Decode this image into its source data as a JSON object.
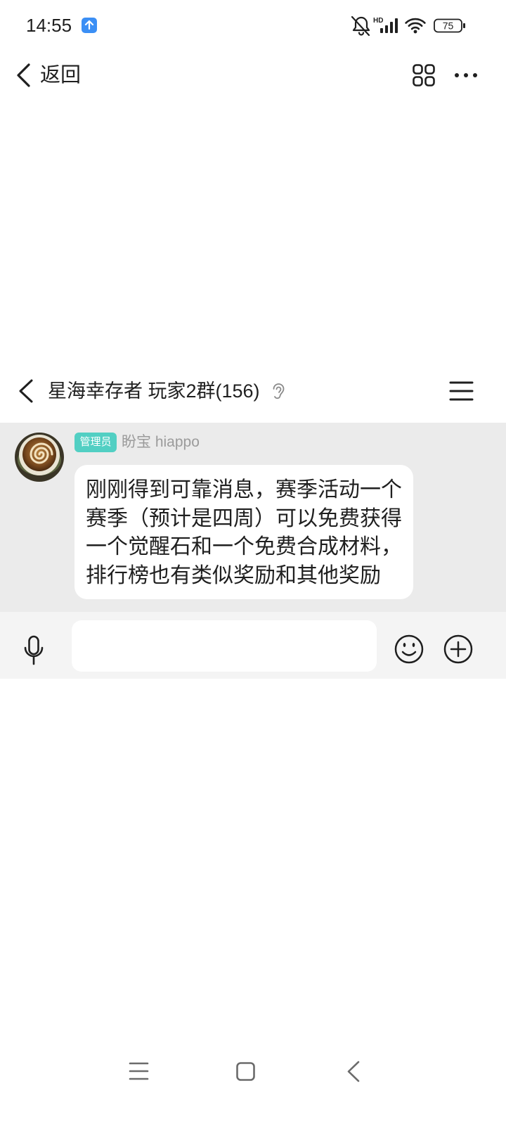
{
  "status_bar": {
    "time": "14:55",
    "network_type": "HD",
    "battery_level": "75",
    "icons": [
      "upload-notification-icon",
      "bell-off-icon",
      "cellular-signal-icon",
      "wifi-icon",
      "battery-icon"
    ]
  },
  "top_nav": {
    "back_label": "返回",
    "icons": [
      "back-chevron-icon",
      "grid-apps-icon",
      "more-dots-icon"
    ]
  },
  "chat_header": {
    "title": "星海幸存者 玩家2群(156)",
    "icons": [
      "back-chevron-icon",
      "ear-icon",
      "menu-icon"
    ]
  },
  "message": {
    "badge": "管理员",
    "sender": "盼宝 hiappo",
    "avatar_icon": "latte-art-avatar",
    "lines": [
      "刚刚得到可靠消息，赛季活动一个",
      "赛季（预计是四周）可以免费获得",
      "一个觉醒石和一个免费合成材料，",
      "排行榜也有类似奖励和其他奖励"
    ]
  },
  "composer": {
    "input_value": "",
    "icons": [
      "microphone-icon",
      "emoji-icon",
      "add-icon"
    ]
  },
  "system_nav": {
    "icons": [
      "recents-menu-icon",
      "home-square-icon",
      "back-chevron-icon"
    ]
  },
  "colors": {
    "background": "#ffffff",
    "message_area": "#ebebeb",
    "composer_bar": "#f4f4f4",
    "bubble": "#ffffff",
    "admin_badge": "#52cfc3",
    "upload_badge": "#3b8ff5",
    "text_primary": "#1f1f1f",
    "text_secondary": "#9b9b9b",
    "icon_muted": "#6b6b6b"
  }
}
